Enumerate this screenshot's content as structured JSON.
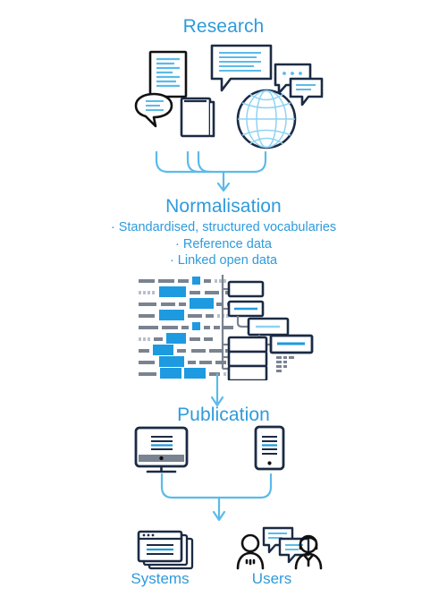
{
  "diagram": {
    "title_research": "Research",
    "title_normalisation": "Normalisation",
    "title_publication": "Publication",
    "label_systems": "Systems",
    "label_users": "Users",
    "normalisation_bullets": [
      "· Standardised, structured vocabularies",
      "· Reference data",
      "· Linked open data"
    ],
    "colors": {
      "accent_blue": "#2e9bdc",
      "light_blue": "#5bbaea",
      "pale_blue": "#8fd3f4",
      "dark_navy": "#1b2b44",
      "ink_black": "#111111",
      "gray": "#7a8390",
      "light_gray": "#b9c0c9",
      "white": "#ffffff"
    },
    "icons": {
      "research": [
        "document-icon",
        "speech-bubble-text-icon",
        "speech-bubble-dots-icon",
        "speech-bubble-small-icon",
        "speech-bubble-quote-icon",
        "book-icon",
        "globe-icon"
      ],
      "normalisation": [
        "data-rows-icon",
        "hierarchy-tree-icon"
      ],
      "publication": [
        "desktop-monitor-icon",
        "tablet-device-icon"
      ],
      "outputs": [
        "stacked-windows-icon",
        "user-person-icon",
        "user-agent-icon",
        "chat-bubbles-icon"
      ]
    },
    "connectors": [
      "research-to-normalisation-bracket-arrow",
      "normalisation-to-publication-arrow",
      "publication-to-outputs-bracket-arrow"
    ]
  }
}
